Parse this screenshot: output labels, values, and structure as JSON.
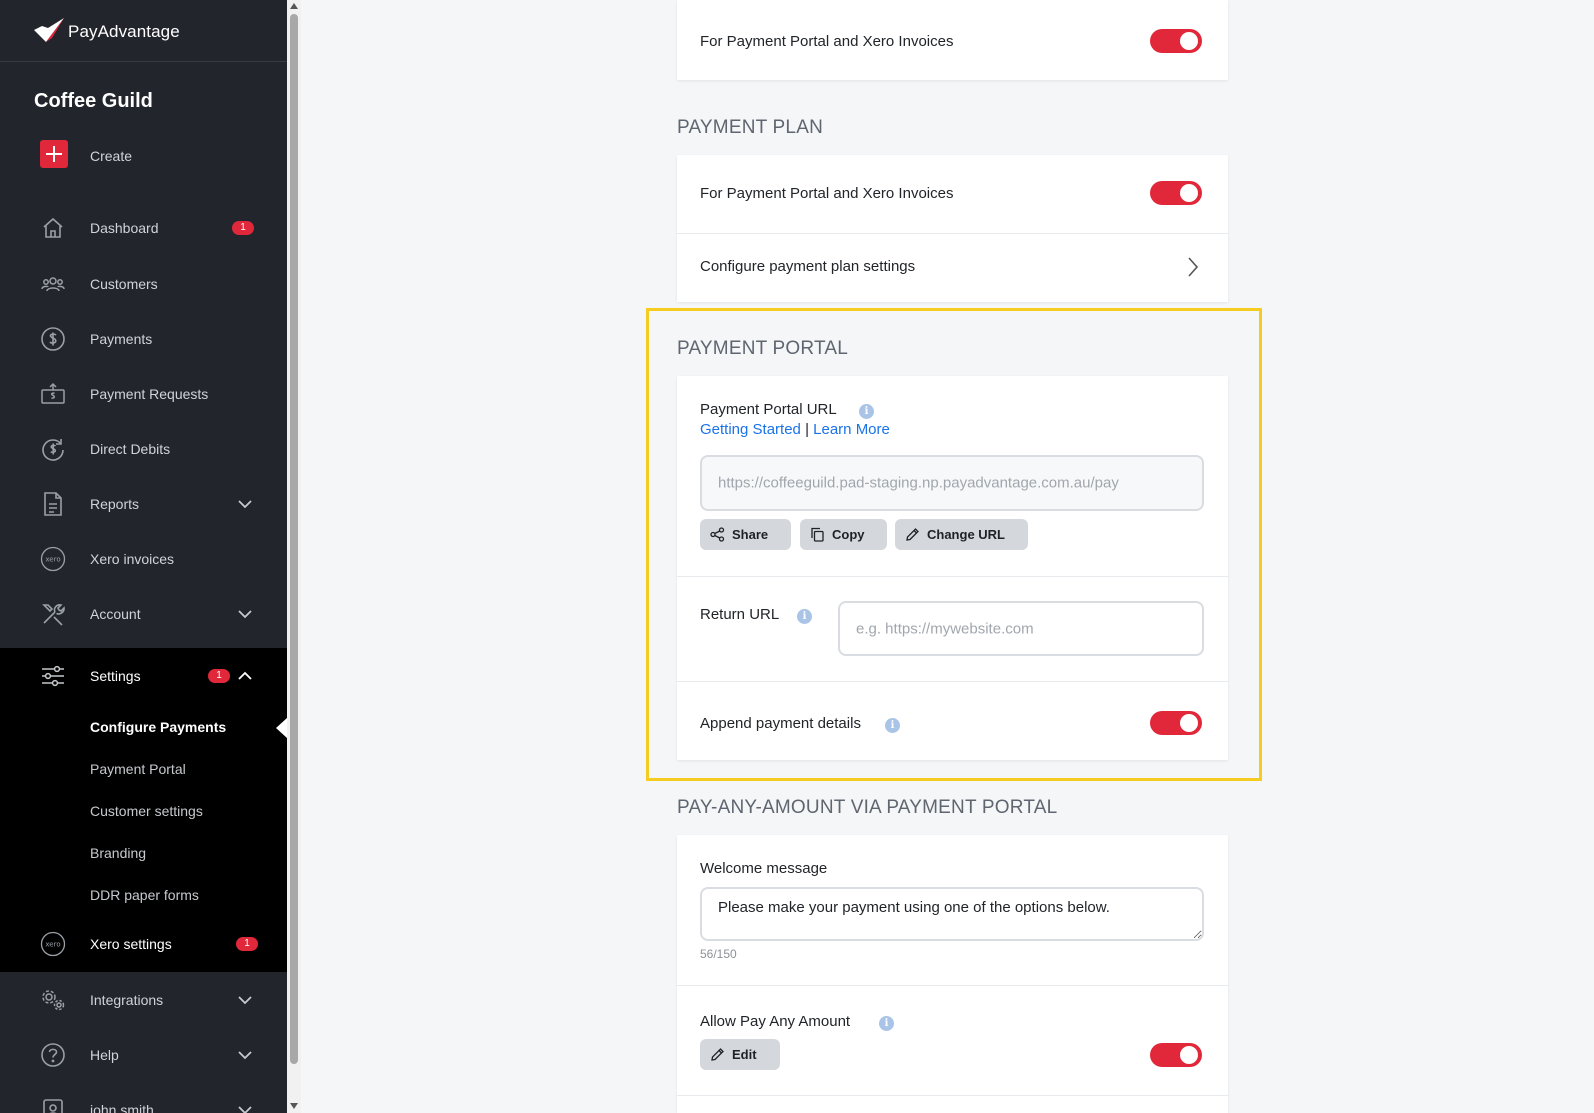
{
  "brand": {
    "name": "PayAdvantage",
    "accent": "#e0283a"
  },
  "sidebar": {
    "org_name": "Coffee Guild",
    "create_label": "Create",
    "items": [
      {
        "label": "Dashboard",
        "badge": "1"
      },
      {
        "label": "Customers"
      },
      {
        "label": "Payments"
      },
      {
        "label": "Payment Requests"
      },
      {
        "label": "Direct Debits"
      },
      {
        "label": "Reports"
      },
      {
        "label": "Xero invoices"
      },
      {
        "label": "Account"
      },
      {
        "label": "Settings",
        "badge": "1"
      },
      {
        "label": "Xero settings",
        "badge": "1"
      },
      {
        "label": "Integrations"
      },
      {
        "label": "Help"
      },
      {
        "label": "john smith"
      }
    ],
    "settings_sub": [
      "Configure Payments",
      "Payment Portal",
      "Customer settings",
      "Branding",
      "DDR paper forms"
    ],
    "active_sub": "Configure Payments"
  },
  "main": {
    "top_card": {
      "label": "For Payment Portal and Xero Invoices",
      "enabled": true
    },
    "payment_plan": {
      "title": "PAYMENT PLAN",
      "toggle_label": "For Payment Portal and Xero Invoices",
      "enabled": true,
      "configure_label": "Configure payment plan settings"
    },
    "payment_portal": {
      "title": "PAYMENT PORTAL",
      "url_label": "Payment Portal URL",
      "link_getting_started": "Getting Started",
      "link_separator": "|",
      "link_learn_more": "Learn More",
      "url_value": "https://coffeeguild.pad-staging.np.payadvantage.com.au/pay",
      "share_label": "Share",
      "copy_label": "Copy",
      "change_url_label": "Change URL",
      "return_url_label": "Return URL",
      "return_url_placeholder": "e.g. https://mywebsite.com",
      "append_label": "Append payment details",
      "append_enabled": true
    },
    "pay_any_amount": {
      "title": "PAY-ANY-AMOUNT VIA PAYMENT PORTAL",
      "welcome_label": "Welcome message",
      "welcome_value": "Please make your payment using one of the options below.",
      "char_count": "56/150",
      "allow_label": "Allow Pay Any Amount",
      "edit_label": "Edit",
      "allow_enabled": true
    }
  }
}
